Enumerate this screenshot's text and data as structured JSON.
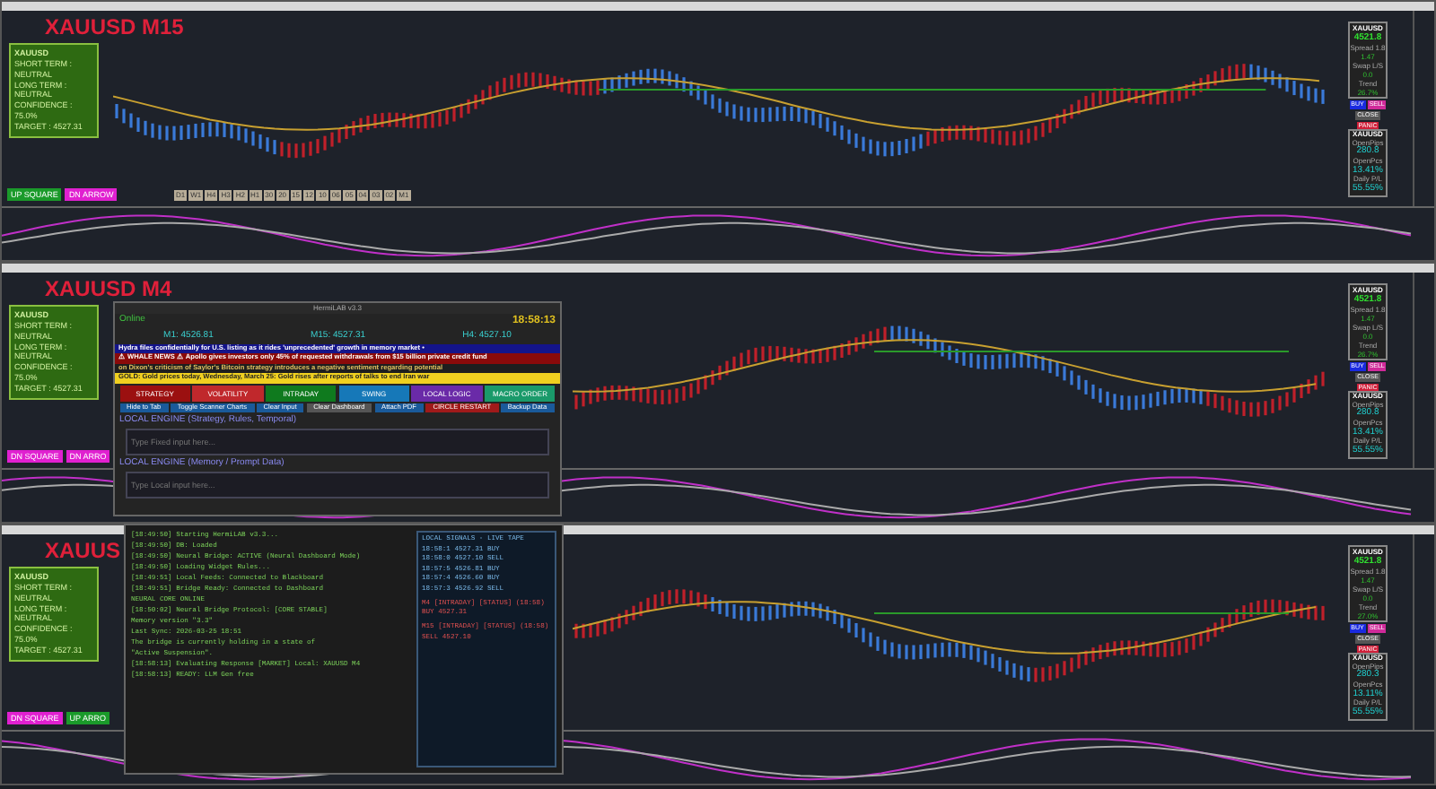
{
  "charts": [
    {
      "title": "XAUUSD M15",
      "info_panel": {
        "header": "XAUUSD",
        "lines": [
          "SHORT TERM : NEUTRAL",
          "LONG TERM : NEUTRAL",
          "CONFIDENCE : 75.0%",
          "TARGET : 4527.31"
        ]
      },
      "signals": [
        {
          "label": "UP SQUARE",
          "kind": "up"
        },
        {
          "label": "DN ARROW",
          "kind": "down"
        }
      ],
      "timeframes": [
        "D1",
        "W1",
        "H4",
        "H3",
        "H2",
        "H1",
        "30",
        "20",
        "15",
        "12",
        "10",
        "06",
        "05",
        "04",
        "03",
        "02",
        "M1"
      ],
      "trade_panel": {
        "symbol": "XAUUSD",
        "price": "4521.8",
        "rows": [
          "Spread 1.8",
          "1.47",
          "Swap L/S",
          "0.0",
          "Trend",
          "26.7%"
        ]
      },
      "account_panel": {
        "symbol": "XAUUSD",
        "rows": [
          "OpenPips",
          "280.8",
          "OpenPcs",
          "13.41%",
          "Daily P/L",
          "55.55%"
        ]
      },
      "buttons": [
        "BUY",
        "SELL",
        "CLOSE",
        "PANIC"
      ]
    },
    {
      "title": "XAUUSD M4",
      "info_panel": {
        "header": "XAUUSD",
        "lines": [
          "SHORT TERM : NEUTRAL",
          "LONG TERM : NEUTRAL",
          "CONFIDENCE : 75.0%",
          "TARGET : 4527.31"
        ]
      },
      "signals": [
        {
          "label": "DN SQUARE",
          "kind": "down"
        },
        {
          "label": "DN ARRO",
          "kind": "down"
        }
      ],
      "trade_panel": {
        "symbol": "XAUUSD",
        "price": "4521.8",
        "rows": [
          "Spread 1.8",
          "1.47",
          "Swap L/S",
          "0.0",
          "Trend",
          "26.7%"
        ]
      },
      "account_panel": {
        "symbol": "XAUUSD",
        "rows": [
          "OpenPips",
          "280.8",
          "OpenPcs",
          "13.41%",
          "Daily P/L",
          "55.55%"
        ]
      },
      "buttons": [
        "BUY",
        "SELL",
        "CLOSE",
        "PANIC"
      ]
    },
    {
      "title": "XAUUS",
      "info_panel": {
        "header": "XAUUSD",
        "lines": [
          "SHORT TERM : NEUTRAL",
          "LONG TERM : NEUTRAL",
          "CONFIDENCE : 75.0%",
          "TARGET : 4527.31"
        ]
      },
      "signals": [
        {
          "label": "DN SQUARE",
          "kind": "down"
        },
        {
          "label": "UP ARRO",
          "kind": "up"
        }
      ],
      "trade_panel": {
        "symbol": "XAUUSD",
        "price": "4521.8",
        "rows": [
          "Spread 1.8",
          "1.47",
          "Swap L/S",
          "0.0",
          "Trend",
          "27.0%"
        ]
      },
      "account_panel": {
        "symbol": "XAUUSD",
        "rows": [
          "OpenPips",
          "280.3",
          "OpenPcs",
          "13.11%",
          "Daily P/L",
          "55.55%"
        ]
      },
      "buttons": [
        "BUY",
        "SELL",
        "CLOSE",
        "PANIC"
      ]
    }
  ],
  "assistant_window": {
    "title": "HermiLAB v3.3",
    "status": "Online",
    "clock": "18:58:13",
    "prices": [
      "M1: 4526.81",
      "M15: 4527.31",
      "H4: 4527.10"
    ],
    "tickers": [
      {
        "text": "Hydra files confidentially for U.S. listing as it rides 'unprecedented' growth in memory market •",
        "kind": "blue"
      },
      {
        "text": "⚠ WHALE NEWS ⚠ Apollo gives investors only 45% of requested withdrawals from $15 billion private credit fund",
        "kind": "red"
      },
      {
        "text": "on Dixon's criticism of Saylor's Bitcoin strategy introduces a negative sentiment regarding potential",
        "kind": "dark"
      },
      {
        "text": "GOLD: Gold prices today, Wednesday, March 25: Gold rises after reports of talks to end Iran war",
        "kind": "yellow"
      }
    ],
    "modes": [
      {
        "label": "STRATEGY",
        "color": "#9b1010"
      },
      {
        "label": "VOLATILITY",
        "color": "#c0282c"
      },
      {
        "label": "INTRADAY",
        "color": "#0f7a1e"
      },
      {
        "label": "SWING",
        "color": "#1678b8"
      },
      {
        "label": "LOCAL LOGIC",
        "color": "#6a2aa8"
      },
      {
        "label": "MACRO ORDER",
        "color": "#1a9a6a"
      }
    ],
    "actions": [
      "Hide to Tab",
      "Toggle Scanner Charts",
      "Clear Input",
      "Clear Dashboard",
      "Attach PDF",
      "CIRCLE RESTART",
      "Backup Data"
    ],
    "inputs": [
      {
        "label": "LOCAL ENGINE (Strategy, Rules, Temporal)",
        "placeholder": "Type Fixed input here..."
      },
      {
        "label": "LOCAL ENGINE (Memory / Prompt Data)",
        "placeholder": "Type Local input here..."
      }
    ]
  },
  "terminal_window": {
    "lines": [
      "[18:49:50] Starting HermiLAB v3.3...",
      "[18:49:50] DB: Loaded",
      "[18:49:50] Neural Bridge: ACTIVE (Neural Dashboard Mode)",
      "[18:49:50] Loading Widget Rules...",
      "[18:49:51] Local Feeds: Connected to Blackboard",
      "[18:49:51] Bridge Ready: Connected to Dashboard",
      "NEURAL CORE ONLINE",
      "[18:50:02] Neural Bridge Protocol: [CORE STABLE]",
      "Memory version \"3.3\"",
      "Last Sync: 2026-03-25 18:51",
      "The bridge is currently holding in a state of",
      "\"Active Suspension\".",
      "[18:58:13] Evaluating Response [MARKET] Local: XAUUSD M4",
      "[18:58:13] READY: LLM Gen free"
    ],
    "tape_title": "LOCAL SIGNALS - LIVE TAPE",
    "tape_rows": [
      "18:58:1 4527.31 BUY",
      "18:58:0 4527.10 SELL",
      "18:57:5 4526.81 BUY",
      "18:57:4 4526.60 BUY",
      "18:57:3 4526.92 SELL"
    ],
    "alerts": [
      "M4 [INTRADAY] [STATUS] (18:58) BUY 4527.31",
      "M15 [INTRADAY] [STATUS] (18:58) SELL 4527.10"
    ]
  }
}
